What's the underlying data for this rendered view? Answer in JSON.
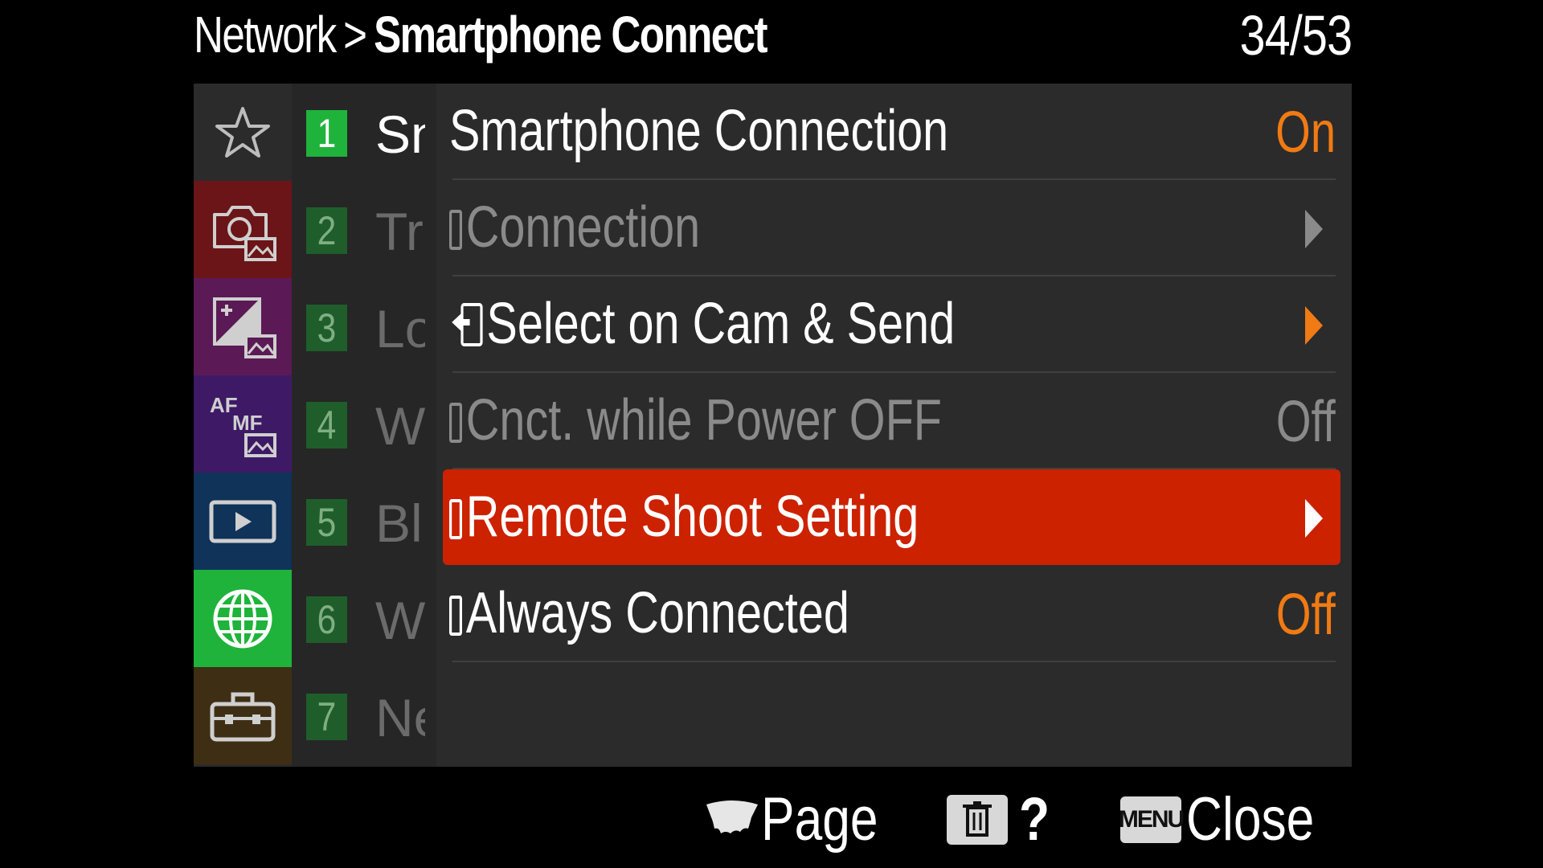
{
  "header": {
    "crumb_parent": "Network",
    "crumb_separator": ">",
    "crumb_current": "Smartphone Connect",
    "page_count": "34/53"
  },
  "categories": [
    {
      "icon": "star-icon",
      "color": "#2b2b2b",
      "active": false
    },
    {
      "icon": "camera-photo-icon",
      "color": "#6b1518",
      "active": false
    },
    {
      "icon": "exposure-image-icon",
      "color": "#5b1a55",
      "active": false
    },
    {
      "icon": "af-mf-icon",
      "color": "#3e1a66",
      "active": false
    },
    {
      "icon": "playback-icon",
      "color": "#0f3359",
      "active": false
    },
    {
      "icon": "globe-icon",
      "color": "#1fb33c",
      "active": true
    },
    {
      "icon": "toolbox-icon",
      "color": "#3e2f14",
      "active": false
    }
  ],
  "subtabs": [
    {
      "num": "1",
      "label": "Sn",
      "active": true
    },
    {
      "num": "2",
      "label": "Tr",
      "active": false
    },
    {
      "num": "3",
      "label": "Lo",
      "active": false
    },
    {
      "num": "4",
      "label": "W",
      "active": false
    },
    {
      "num": "5",
      "label": "Bl",
      "active": false
    },
    {
      "num": "6",
      "label": "W",
      "active": false
    },
    {
      "num": "7",
      "label": "Ne",
      "active": false
    }
  ],
  "items": [
    {
      "label": "Smartphone Connection",
      "value": "On",
      "value_color": "orange",
      "arrow": null,
      "dim": false
    },
    {
      "label": "Connection",
      "value": "",
      "arrow": "gray",
      "dim": true
    },
    {
      "label": "Select on Cam & Send",
      "value": "",
      "arrow": "orange",
      "dim": false
    },
    {
      "label": "Cnct. while Power OFF",
      "value": "Off",
      "value_color": "gray",
      "arrow": null,
      "dim": true
    },
    {
      "label": "Remote Shoot Setting",
      "value": "",
      "arrow": "white",
      "dim": false,
      "selected": true
    },
    {
      "label": "Always Connected",
      "value": "Off",
      "value_color": "orange",
      "arrow": null,
      "dim": false
    }
  ],
  "footer": {
    "page_label": "Page",
    "help_label": "?",
    "menu_badge": "MENU",
    "close_label": "Close"
  },
  "colors": {
    "accent_orange": "#f07a14",
    "selection_red": "#cc2200",
    "active_green": "#1fb33c"
  }
}
